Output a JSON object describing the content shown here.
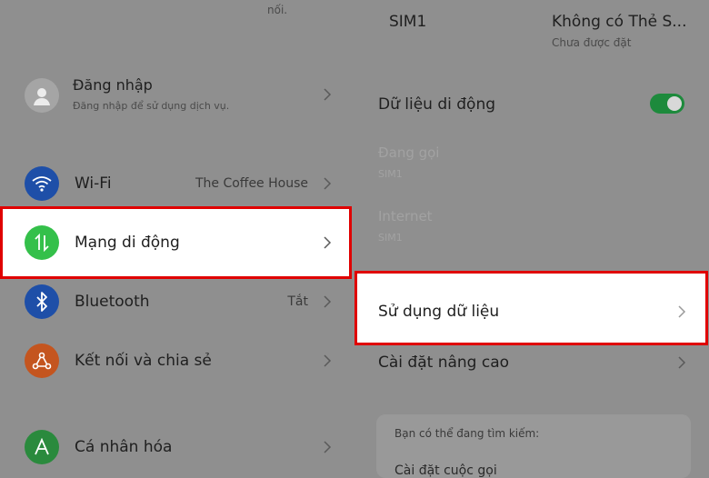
{
  "left": {
    "top_fragment": "nối.",
    "login": {
      "title": "Đăng nhập",
      "subtitle": "Đăng nhập để sử dụng dịch vụ."
    },
    "wifi": {
      "label": "Wi-Fi",
      "value": "The Coffee House"
    },
    "mobile_network": {
      "label": "Mạng di động"
    },
    "bluetooth": {
      "label": "Bluetooth",
      "value": "Tắt"
    },
    "connection_sharing": {
      "label": "Kết nối và chia sẻ"
    },
    "personalization": {
      "label": "Cá nhân hóa"
    }
  },
  "right": {
    "sim_tabs": [
      {
        "label": "SIM1"
      },
      {
        "label": "Không có Thẻ S...",
        "sub": "Chưa được đặt"
      }
    ],
    "mobile_data": {
      "label": "Dữ liệu di động",
      "enabled": true
    },
    "calling": {
      "label": "Đang gọi",
      "sub": "SIM1"
    },
    "internet": {
      "label": "Internet",
      "sub": "SIM1"
    },
    "data_usage": {
      "label": "Sử dụng dữ liệu"
    },
    "advanced": {
      "label": "Cài đặt nâng cao"
    },
    "suggestions": {
      "heading": "Bạn có thể đang tìm kiếm:",
      "first_item": "Cài đặt cuộc gọi"
    }
  },
  "colors": {
    "highlight_border": "#e00000",
    "wifi_icon_bg": "#1e4fa8",
    "mobile_icon_bg": "#34c04a",
    "bluetooth_icon_bg": "#1e4fa8",
    "sharing_icon_bg": "#c4551f",
    "personalization_icon_bg": "#2a8a3d",
    "toggle_on": "#1d8a3c"
  },
  "icons": [
    "avatar-icon",
    "wifi-icon",
    "mobile-data-icon",
    "bluetooth-icon",
    "share-icon",
    "personalization-icon",
    "chevron-right-icon"
  ]
}
